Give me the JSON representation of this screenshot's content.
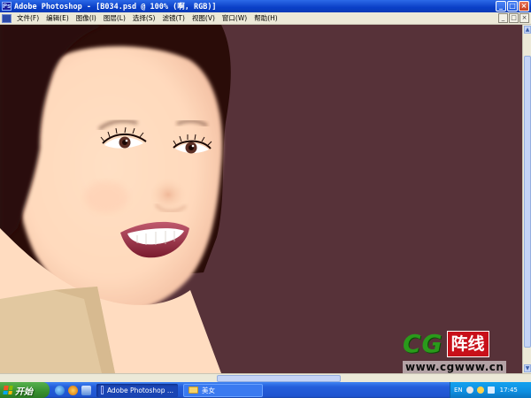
{
  "window": {
    "title": "Adobe Photoshop - [B034.psd @ 100% (啊, RGB)]",
    "buttons": [
      "_",
      "□",
      "×"
    ],
    "app_icon_glyph": "Ps"
  },
  "menu": {
    "items": [
      "文件(F)",
      "编辑(E)",
      "图像(I)",
      "图层(L)",
      "选择(S)",
      "滤镜(T)",
      "视图(V)",
      "窗口(W)",
      "帮助(H)"
    ],
    "right_buttons": [
      "_",
      "□",
      "×"
    ]
  },
  "canvas": {
    "background_color": "#573239",
    "skin_color": "#ffdcc0",
    "hair_color": "#2a0c08",
    "collar_color": "#e2c8a0"
  },
  "watermark": {
    "cg": "CG",
    "box": "阵线",
    "url": "www.cgwww.cn"
  },
  "taskbar": {
    "start_label": "开始",
    "tasks": [
      {
        "label": "Adobe Photoshop ...",
        "icon": "photoshop-icon",
        "active": true
      },
      {
        "label": "美女",
        "icon": "folder-icon",
        "active": false
      }
    ],
    "tray": {
      "lang": "EN",
      "time": "17:45"
    }
  }
}
